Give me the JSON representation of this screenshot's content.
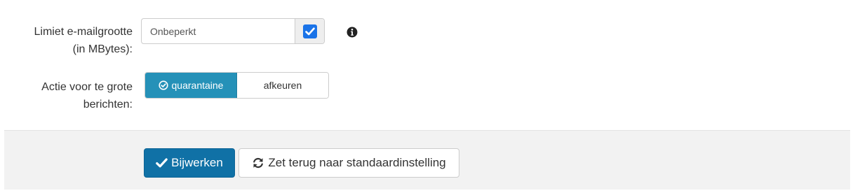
{
  "size_limit": {
    "label_line1": "Limiet e-mailgrootte",
    "label_line2": "(in MBytes):",
    "value": "Onbeperkt",
    "unlimited_checked": true,
    "info_icon": "info-circle-icon"
  },
  "oversize_action": {
    "label_line1": "Actie voor te grote",
    "label_line2": "berichten:",
    "options": [
      {
        "label": "quarantaine",
        "selected": true,
        "icon": "check-circle-icon"
      },
      {
        "label": "afkeuren",
        "selected": false
      }
    ],
    "active_color": "#2591b8"
  },
  "footer": {
    "update_label": "Bijwerken",
    "update_icon": "checkmark-icon",
    "update_color": "#1071a6",
    "reset_label": "Zet terug naar standaardinstelling",
    "reset_icon": "refresh-icon"
  }
}
